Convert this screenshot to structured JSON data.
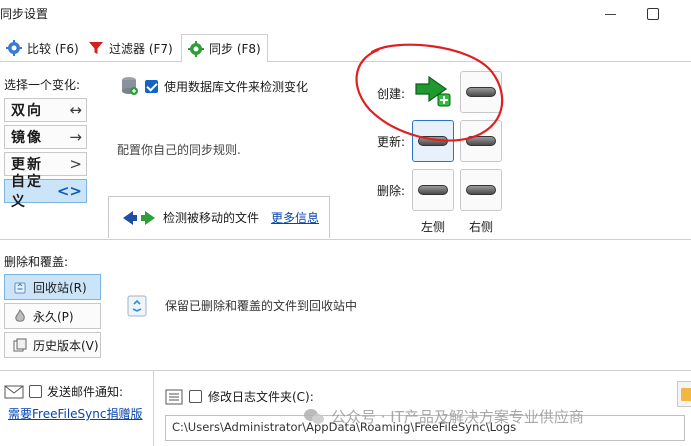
{
  "window": {
    "title": "同步设置"
  },
  "tabs": [
    {
      "label": "比较 (F6)",
      "icon": "gear-icon"
    },
    {
      "label": "过滤器 (F7)",
      "icon": "filter-icon"
    },
    {
      "label": "同步 (F8)",
      "icon": "sync-gear-icon",
      "active": true
    }
  ],
  "variant": {
    "label": "选择一个变化:",
    "options": [
      {
        "label": "双向",
        "symbol": "↔"
      },
      {
        "label": "镜像",
        "symbol": "→"
      },
      {
        "label": "更新",
        "symbol": ">"
      },
      {
        "label": "自定义",
        "symbol": "<>",
        "selected": true
      }
    ]
  },
  "database": {
    "label": "使用数据库文件来检测变化",
    "checked": true
  },
  "hint": "配置你自己的同步规则.",
  "moved_files": {
    "label": "检测被移动的文件",
    "link": "更多信息"
  },
  "operations": {
    "rows": [
      {
        "label": "创建:"
      },
      {
        "label": "更新:"
      },
      {
        "label": "删除:"
      }
    ],
    "left_label": "左侧",
    "right_label": "右侧"
  },
  "deletion": {
    "label": "删除和覆盖:",
    "options": [
      {
        "label": "回收站(R)",
        "icon": "recycle-bin-icon",
        "selected": true
      },
      {
        "label": "永久(P)",
        "icon": "flame-icon"
      },
      {
        "label": "历史版本(V)",
        "icon": "versioning-icon"
      }
    ],
    "description": "保留已删除和覆盖的文件到回收站中"
  },
  "email": {
    "label": "发送邮件通知:",
    "checked": false,
    "link": "需要FreeFileSync捐赠版"
  },
  "log": {
    "label": "修改日志文件夹(C):",
    "checked": false,
    "path": "C:\\Users\\Administrator\\AppData\\Roaming\\FreeFileSync\\Logs"
  },
  "watermark": "公众号 · IT产品及解决方案专业供应商",
  "colors": {
    "accent": "#0b5fb4",
    "selected_bg": "#cce4f7",
    "link": "#0645ad",
    "annotation": "#e02020",
    "create_arrow": "#1e9a2e"
  }
}
